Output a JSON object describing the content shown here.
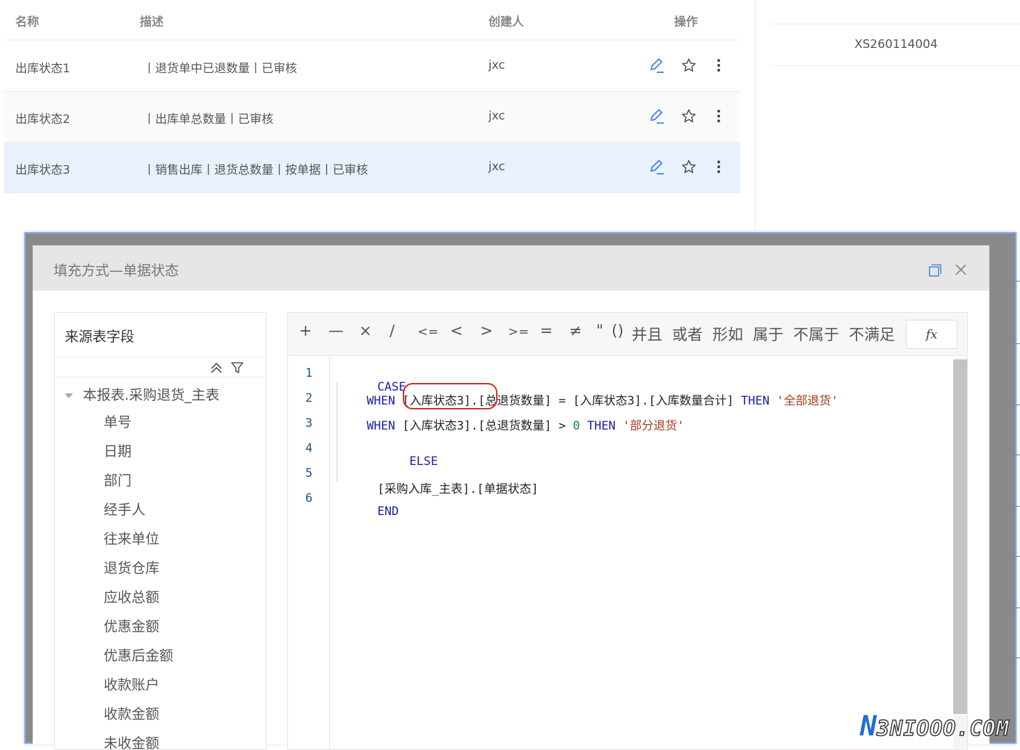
{
  "list": {
    "headers": {
      "name": "名称",
      "desc": "描述",
      "creator": "创建人",
      "actions": "操作"
    },
    "rows": [
      {
        "name": "出库状态1",
        "desc": "丨退货单中已退数量丨已审核",
        "creator": "jxc"
      },
      {
        "name": "出库状态2",
        "desc": "丨出库单总数量丨已审核",
        "creator": "jxc"
      },
      {
        "name": "出库状态3",
        "desc": "丨销售出库丨退货总数量丨按单据丨已审核",
        "creator": "jxc"
      }
    ]
  },
  "right_panel": {
    "code": "XS260114004"
  },
  "modal": {
    "title": "填充方式—单据状态",
    "field_panel": {
      "title": "来源表字段",
      "root": "本报表.采购退货_主表",
      "items": [
        "单号",
        "日期",
        "部门",
        "经手人",
        "往来单位",
        "退货仓库",
        "应收总额",
        "优惠金额",
        "优惠后金额",
        "收款账户",
        "收款金额",
        "未收金额"
      ]
    },
    "operators": [
      "+",
      "—",
      "×",
      "∕",
      "<=",
      "<",
      ">",
      ">=",
      "=",
      "≠",
      "\"",
      "()",
      "并且",
      "或者",
      "形如",
      "属于",
      "不属于",
      "不满足"
    ],
    "fx_label": "fx",
    "line_numbers": [
      "1",
      "2",
      "3",
      "4",
      "5",
      "6"
    ],
    "code": {
      "l1_kw": "CASE",
      "l2_kw1": "WHEN",
      "l2_field1": "[入库状态3]",
      "l2_mid": ".[总退货数量] = [入库状态3].[入库数量合计]",
      "l2_kw2": "THEN",
      "l2_str": "'全部退货'",
      "l3_kw1": "WHEN",
      "l3_mid": "[入库状态3].[总退货数量] >",
      "l3_num": "0",
      "l3_kw2": "THEN",
      "l3_str": "'部分退货'",
      "l4_kw": "ELSE",
      "l5_text": "[采购入库_主表].[单据状态]",
      "l6_kw": "END"
    }
  },
  "watermark": {
    "n": "N",
    "rest": "3NIOOO.COM"
  },
  "colors": {
    "accent": "#1f6fd1",
    "keyword": "#1b22a6",
    "string": "#a33a1a",
    "highlight": "#d12a1f"
  }
}
